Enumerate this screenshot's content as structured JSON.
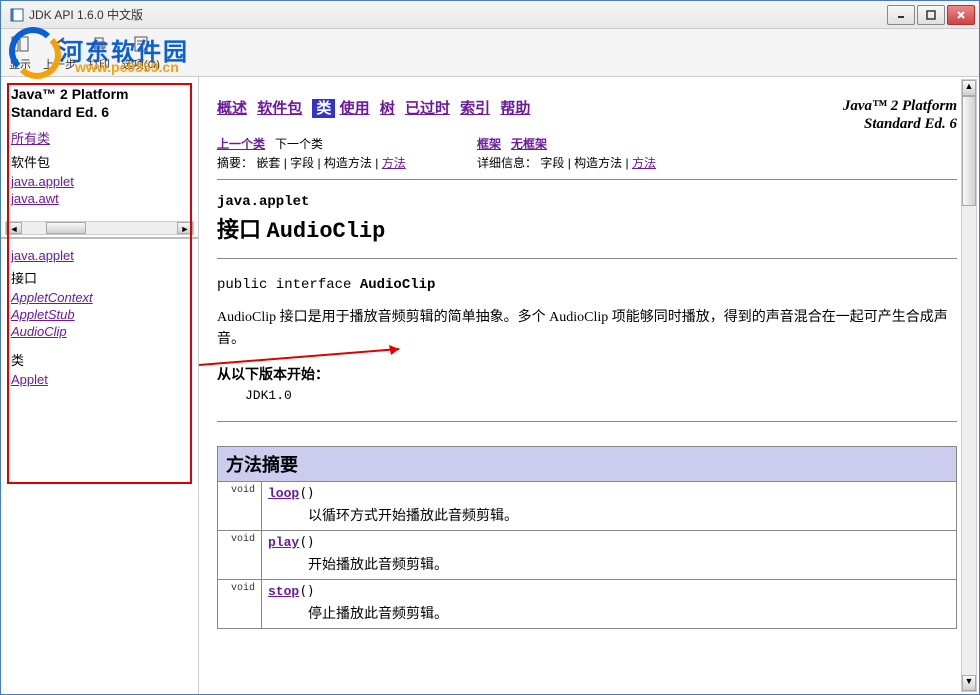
{
  "window": {
    "title": "JDK API 1.6.0 中文版"
  },
  "toolbar": {
    "show": "显示",
    "back": "上一步",
    "print": "打印",
    "options": "选项(O)"
  },
  "watermark": {
    "name": "河东软件园",
    "url": "www.pc0359.cn"
  },
  "sidebar_top": {
    "heading_line1": "Java™ 2 Platform",
    "heading_line2": "Standard Ed. 6",
    "all_classes": "所有类",
    "packages_label": "软件包",
    "packages": [
      "java.applet",
      "java.awt"
    ]
  },
  "sidebar_bottom": {
    "package": "java.applet",
    "interfaces_label": "接口",
    "interfaces": [
      "AppletContext",
      "AppletStub",
      "AudioClip"
    ],
    "classes_label": "类",
    "classes": [
      "Applet"
    ]
  },
  "main": {
    "nav": {
      "overview": "概述",
      "package": "软件包",
      "class": "类",
      "use": "使用",
      "tree": "树",
      "deprecated": "已过时",
      "index": "索引",
      "help": "帮助"
    },
    "platform_line1": "Java™ 2 Platform",
    "platform_line2": "Standard Ed. 6",
    "subnav": {
      "prev_class": "上一个类",
      "next_class": "下一个类",
      "frames": "框架",
      "no_frames": "无框架",
      "summary_label": "摘要：",
      "summary_items": "嵌套 | 字段 | 构造方法 | ",
      "summary_method": "方法",
      "detail_label": "详细信息：",
      "detail_items": "字段 | 构造方法 | ",
      "detail_method": "方法"
    },
    "package_name": "java.applet",
    "class_heading_prefix": "接口 ",
    "class_heading_name": "AudioClip",
    "signature_pre": "public interface ",
    "signature_name": "AudioClip",
    "description": "AudioClip 接口是用于播放音频剪辑的简单抽象。多个 AudioClip 项能够同时播放，得到的声音混合在一起可产生合成声音。",
    "since_label": "从以下版本开始：",
    "since_value": "JDK1.0",
    "method_summary_title": "方法摘要",
    "methods": [
      {
        "ret": "void",
        "name": "loop",
        "sig": "()",
        "desc": "以循环方式开始播放此音频剪辑。"
      },
      {
        "ret": "void",
        "name": "play",
        "sig": "()",
        "desc": "开始播放此音频剪辑。"
      },
      {
        "ret": "void",
        "name": "stop",
        "sig": "()",
        "desc": "停止播放此音频剪辑。"
      }
    ]
  }
}
